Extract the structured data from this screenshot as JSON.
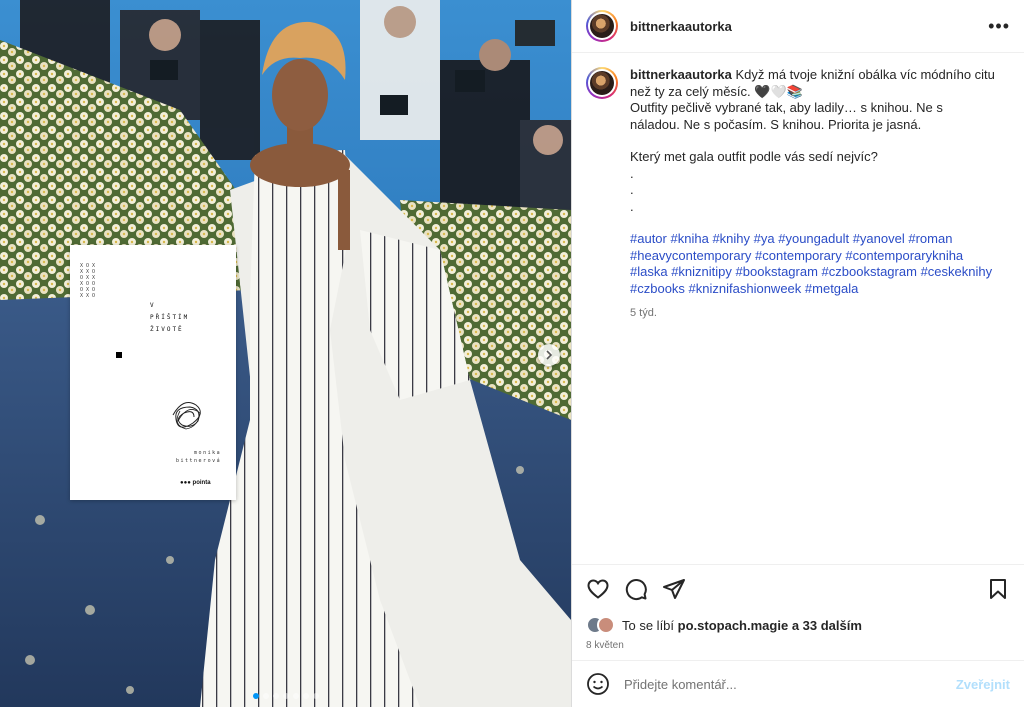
{
  "post": {
    "username": "bittnerkaautorka",
    "more_label": "•••",
    "caption": {
      "lines": [
        "Když má tvoje knižní obálka víc módního citu než ty za celý měsíc. 🖤🤍📚",
        "Outfity pečlivě vybrané tak, aby ladily… s knihou. Ne s náladou. Ne s počasím. S knihou. Priorita je jasná.",
        "Který met gala outfit podle vás sedí nejvíc?",
        ".",
        ".",
        "."
      ],
      "hashtags": [
        "#autor",
        "#kniha",
        "#knihy",
        "#ya",
        "#youngadult",
        "#yanovel",
        "#roman",
        "#heavycontemporary",
        "#contemporary",
        "#contemporarykniha",
        "#laska",
        "#kniznitipy",
        "#bookstagram",
        "#czbookstagram",
        "#ceskeknihy",
        "#czbooks",
        "#kniznifashionweek",
        "#metgala"
      ],
      "time": "5 týd."
    },
    "likes": {
      "prefix": "To se líbí",
      "user": "po.stopach.magie",
      "suffix": "a 33 dalším"
    },
    "date": "8 květen",
    "comment_input": {
      "placeholder": "Přidejte komentář..."
    },
    "post_button": "Zveřejnit"
  },
  "media": {
    "book": {
      "title": "V\nPŘÍŠTÍM\nŽIVOTĚ",
      "author": "monika\nbittnerová",
      "publisher": "●●● pointa"
    },
    "carousel": {
      "count": 7,
      "active": 0
    }
  },
  "colors": {
    "link": "#2b4dc7",
    "accent": "#0095f6",
    "post_disabled": "#b2dffc"
  }
}
